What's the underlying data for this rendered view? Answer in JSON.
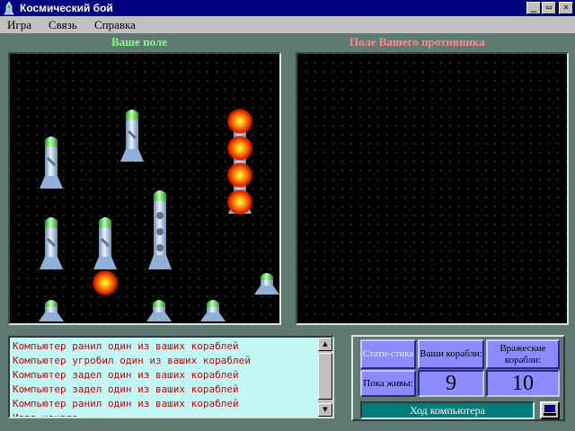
{
  "window": {
    "title": "Космический бой",
    "minimize": "_",
    "maximize": "▭",
    "close": "✕"
  },
  "menu": {
    "game": "Игра",
    "link": "Связь",
    "help": "Справка"
  },
  "fields": {
    "own_title": "Ваше поле",
    "enemy_title": "Поле Вашего противника"
  },
  "log": {
    "lines": [
      "Компьютер ранил один из ваших кораблей",
      "Компьютер угробил один из ваших кораблей",
      "Компьютер задел один из ваших кораблей",
      "Компьютер задел один из ваших кораблей",
      "Компьютер ранил один из ваших кораблей",
      "Игра начата"
    ]
  },
  "stats": {
    "header_label": "Стати-стика",
    "your_ships_label": "Ваши корабли:",
    "enemy_ships_label": "Вражеские корабли:",
    "alive_label": "Пока живы:",
    "your_ships_count": "9",
    "enemy_ships_count": "10",
    "turn_status": "Ход компьютера"
  },
  "colors": {
    "own_title": "#88ff88",
    "enemy_title": "#ff8b8b",
    "log_text": "#d00000",
    "log_bg": "#c3f7f4",
    "stat_cell": "#8b8bff",
    "turn_bg": "#007c7c"
  },
  "icons": {
    "app": "rocket-icon",
    "computer": "computer-icon",
    "ship": "rocket-ship-icon",
    "hit": "explosion-icon"
  }
}
